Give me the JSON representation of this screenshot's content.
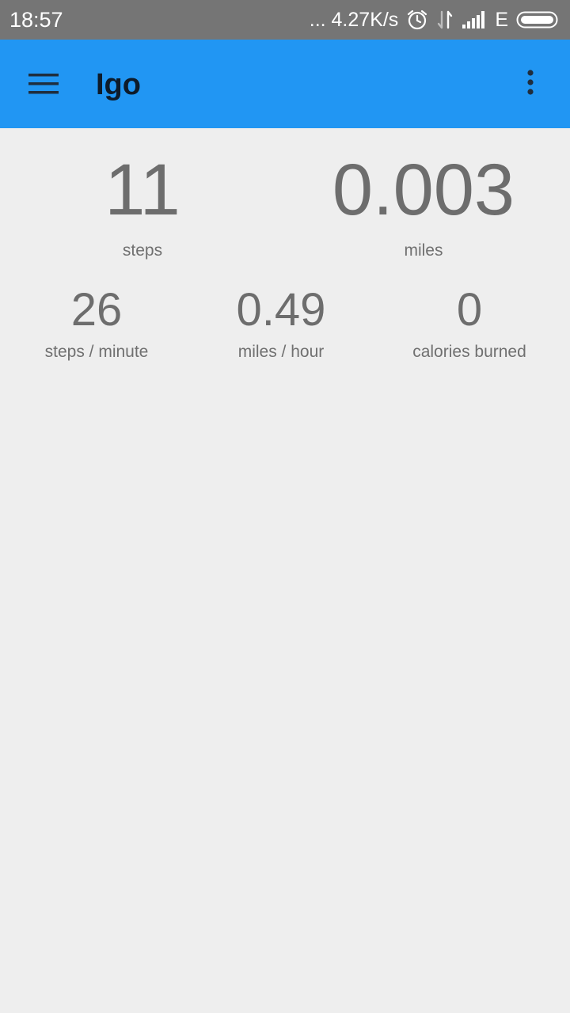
{
  "status_bar": {
    "time": "18:57",
    "network_speed": "... 4.27K/s",
    "network_type": "E",
    "icons": [
      "alarm-icon",
      "data-transfer-icon",
      "signal-icon",
      "battery-icon"
    ]
  },
  "app_bar": {
    "title": "Igo",
    "color": "#2196f3",
    "icons": [
      "menu-icon",
      "overflow-menu-icon"
    ]
  },
  "stats": {
    "steps": {
      "value": "11",
      "label": "steps"
    },
    "miles": {
      "value": "0.003",
      "label": "miles"
    },
    "steps_per_minute": {
      "value": "26",
      "label": "steps / minute"
    },
    "miles_per_hour": {
      "value": "0.49",
      "label": "miles / hour"
    },
    "calories": {
      "value": "0",
      "label": "calories burned"
    }
  }
}
